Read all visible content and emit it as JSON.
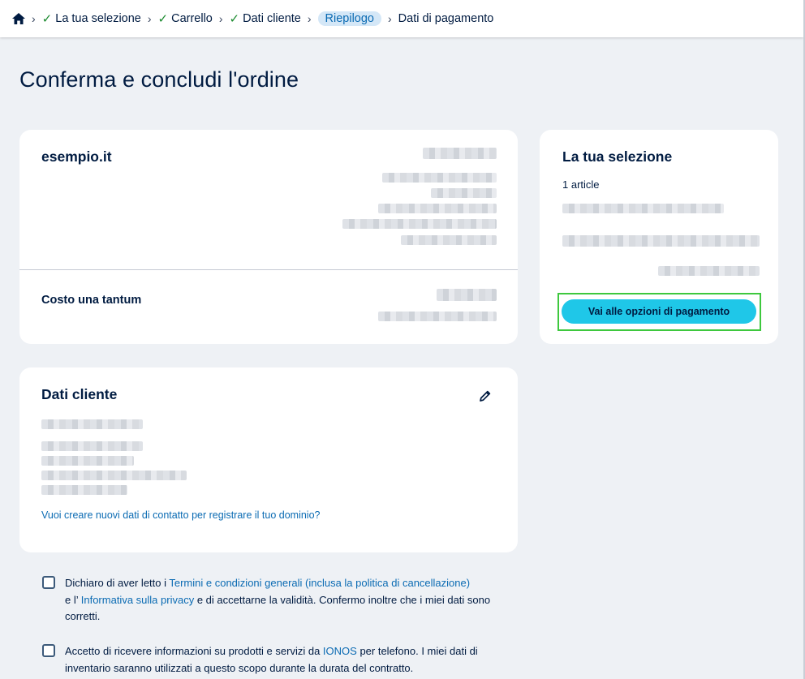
{
  "breadcrumb": {
    "items": [
      {
        "label": "La tua selezione"
      },
      {
        "label": "Carrello"
      },
      {
        "label": "Dati cliente"
      },
      {
        "label": "Riepilogo"
      },
      {
        "label": "Dati di pagamento"
      }
    ]
  },
  "page": {
    "title": "Conferma e concludi l'ordine"
  },
  "order": {
    "domain": "esempio.it",
    "one_time_cost_label": "Costo una tantum"
  },
  "selection": {
    "title": "La tua selezione",
    "articles": "1 article",
    "pay_button": "Vai alle opzioni di pagamento"
  },
  "customer": {
    "title": "Dati cliente",
    "new_contact_link": "Vuoi creare nuovi dati di contatto per registrare il tuo dominio?"
  },
  "consents": {
    "terms": {
      "prefix": "Dichiaro di aver letto i ",
      "terms_link": "Termini e condizioni generali (inclusa la politica di cancellazione)",
      "mid": "e l’ ",
      "privacy_link": "Informativa sulla privacy",
      "suffix": " e di accettarne la validità. Confermo inoltre che i miei dati sono corretti."
    },
    "marketing": {
      "prefix": "Accetto di ricevere informazioni su prodotti e servizi da ",
      "brand_link": "IONOS",
      "suffix": " per telefono. I miei dati di inventario saranno utilizzati a questo scopo durante la durata del contratto."
    }
  },
  "colors": {
    "primary_button": "#1fc7e8",
    "link": "#0b6bb3",
    "check": "#1a8a2e",
    "highlight_border": "#3ec83e"
  }
}
